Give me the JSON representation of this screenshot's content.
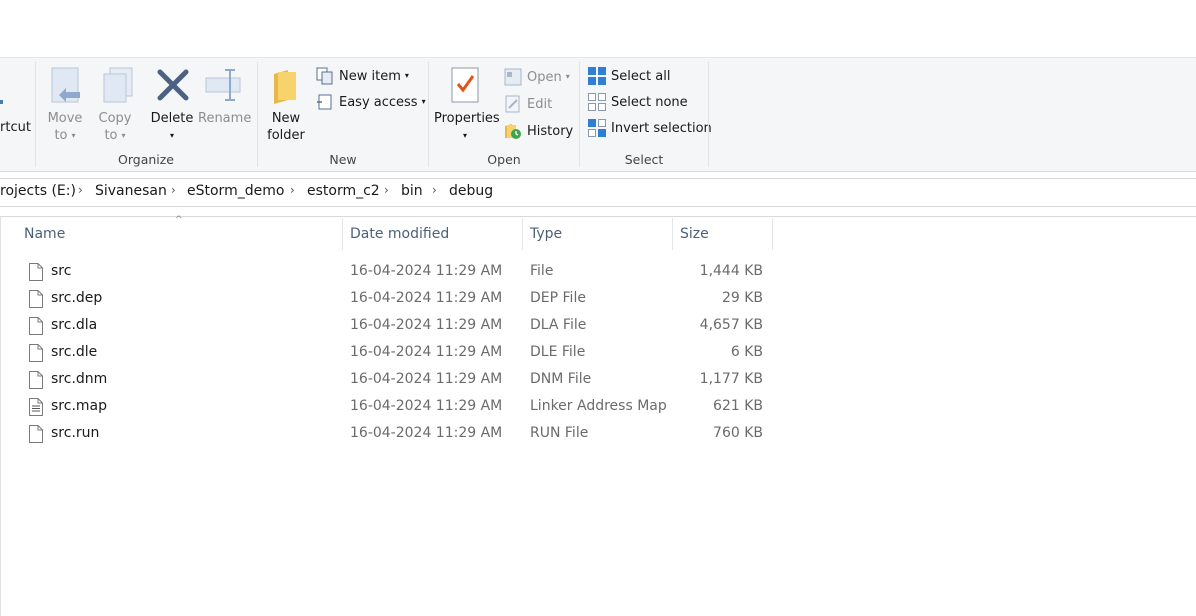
{
  "ribbon": {
    "shortcut_partial": "rtcut",
    "organize": {
      "label": "Organize",
      "move_to": [
        "Move",
        "to"
      ],
      "copy_to": [
        "Copy",
        "to"
      ],
      "delete": "Delete",
      "rename": "Rename"
    },
    "new": {
      "label": "New",
      "new_folder": [
        "New",
        "folder"
      ],
      "new_item": "New item",
      "easy_access": "Easy access"
    },
    "open": {
      "label": "Open",
      "properties": "Properties",
      "open": "Open",
      "edit": "Edit",
      "history": "History"
    },
    "select": {
      "label": "Select",
      "select_all": "Select all",
      "select_none": "Select none",
      "invert_selection": "Invert selection"
    }
  },
  "address": {
    "crumbs": [
      "rojects (E:)",
      "Sivanesan",
      "eStorm_demo",
      "estorm_c2",
      "bin",
      "debug"
    ]
  },
  "columns": {
    "name": "Name",
    "date": "Date modified",
    "type": "Type",
    "size": "Size"
  },
  "files": [
    {
      "name": "src",
      "date": "16-04-2024 11:29 AM",
      "type": "File",
      "size": "1,444 KB",
      "icon": "file-icon"
    },
    {
      "name": "src.dep",
      "date": "16-04-2024 11:29 AM",
      "type": "DEP File",
      "size": "29 KB",
      "icon": "file-icon"
    },
    {
      "name": "src.dla",
      "date": "16-04-2024 11:29 AM",
      "type": "DLA File",
      "size": "4,657 KB",
      "icon": "file-icon"
    },
    {
      "name": "src.dle",
      "date": "16-04-2024 11:29 AM",
      "type": "DLE File",
      "size": "6 KB",
      "icon": "file-icon"
    },
    {
      "name": "src.dnm",
      "date": "16-04-2024 11:29 AM",
      "type": "DNM File",
      "size": "1,177 KB",
      "icon": "file-icon"
    },
    {
      "name": "src.map",
      "date": "16-04-2024 11:29 AM",
      "type": "Linker Address Map",
      "size": "621 KB",
      "icon": "text-file-icon"
    },
    {
      "name": "src.run",
      "date": "16-04-2024 11:29 AM",
      "type": "RUN File",
      "size": "760 KB",
      "icon": "file-icon"
    }
  ]
}
